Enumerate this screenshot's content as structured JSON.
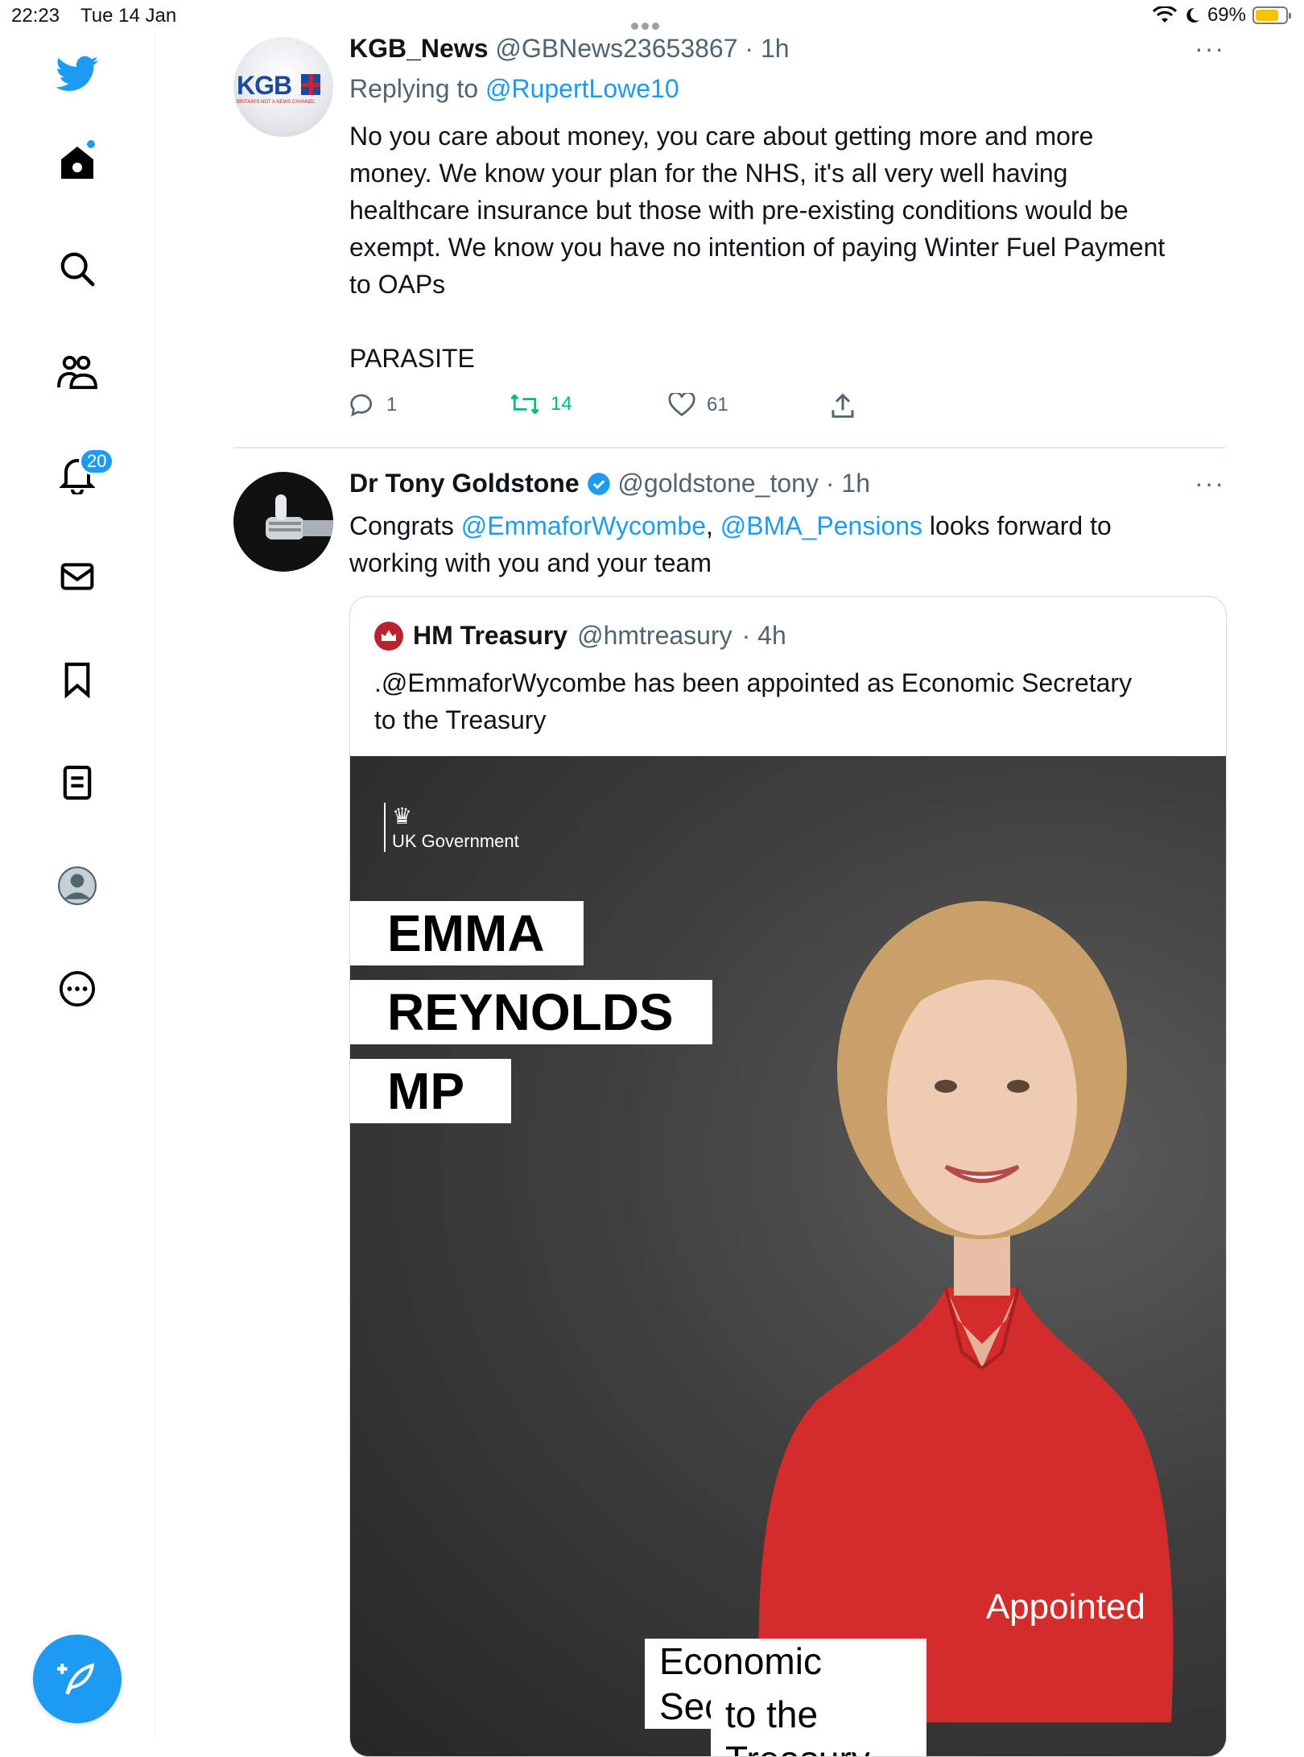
{
  "status_bar": {
    "time": "22:23",
    "date": "Tue 14 Jan",
    "battery": "69%",
    "battery_level": 0.69
  },
  "sidebar": {
    "notifications_badge": "20",
    "items": [
      "twitter-logo",
      "home",
      "search",
      "communities",
      "notifications",
      "messages",
      "bookmarks",
      "lists",
      "profile",
      "more"
    ]
  },
  "tweet1": {
    "avatar_text": "KGB",
    "avatar_tagline": "BRITAIN'S NOT A NEWS CHANNEL",
    "name": "KGB_News",
    "handle": "@GBNews23653867",
    "time": "· 1h",
    "replying_to_label": "Replying to",
    "replying_to_handle": "@RupertLowe10",
    "text_line1": "No you care about money, you care about getting more and more",
    "text_line2": "money. We know your plan for the NHS, it's all very well having",
    "text_line3": "healthcare insurance but those with pre-existing conditions would be",
    "text_line4": "exempt. We know you have no intention of paying Winter Fuel Payment",
    "text_line5": "to OAPs",
    "text_line6": "PARASITE",
    "replies": "1",
    "retweets": "14",
    "likes": "61",
    "more": "···"
  },
  "tweet2": {
    "name": "Dr Tony Goldstone",
    "handle": "@goldstone_tony",
    "time": "· 1h",
    "text_prefix": "Congrats ",
    "mention1": "@EmmaforWycombe",
    "comma": ",",
    "mention2": "@BMA_Pensions",
    "text_suffix": " looks forward to",
    "text_line2": "working with you and your team",
    "more": "···"
  },
  "quote": {
    "name": "HM Treasury",
    "handle": "@hmtreasury",
    "time": "· 4h",
    "text_line1": ".@EmmaforWycombe has been appointed as Economic Secretary",
    "text_line2": "to the Treasury",
    "image": {
      "org": "UK Government",
      "name_line1": "EMMA",
      "name_line2": "REYNOLDS",
      "name_line3": "MP",
      "appointed": "Appointed",
      "role_line1": "Economic Secretary",
      "role_line2": "to the Treasury"
    }
  }
}
